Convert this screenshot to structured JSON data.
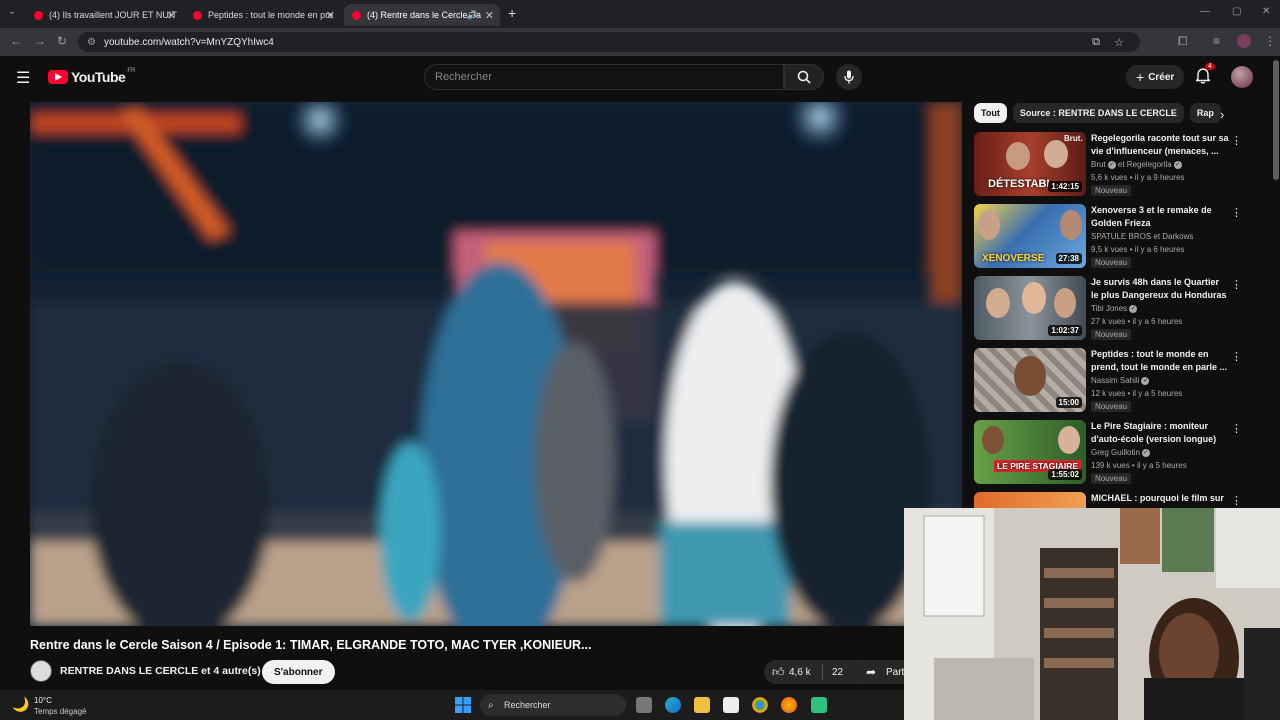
{
  "browser": {
    "tabs": [
      {
        "title": "(4) Ils travaillent JOUR ET NUIT",
        "close": "✕"
      },
      {
        "title": "Peptides : tout le monde en pre",
        "close": "✕"
      },
      {
        "title": "(4) Rentre dans le Cercle Sa",
        "close": "✕",
        "active": true
      }
    ],
    "new_tab": "+",
    "url": "youtube.com/watch?v=MnYZQYhIwc4"
  },
  "youtube": {
    "logo_text": "YouTube",
    "logo_region": "FR",
    "search_placeholder": "Rechercher",
    "create_label": "Créer",
    "notification_count": "4"
  },
  "video": {
    "title": "Rentre dans le Cercle Saison 4 / Episode 1: TIMAR, ELGRANDE TOTO, MAC TYER ,KONIEUR...",
    "channel": "RENTRE DANS LE CERCLE et 4 autre(s)",
    "subscribe_label": "S'abonner",
    "likes": "4,6 k",
    "dislike_count": "22",
    "share_label": "Part"
  },
  "chips": [
    {
      "label": "Tout",
      "active": true
    },
    {
      "label": "Source : RENTRE DANS LE CERCLE"
    },
    {
      "label": "Rap"
    }
  ],
  "recommendations": [
    {
      "title": "Regelegorila raconte tout sur sa vie d'influenceur (menaces, ...",
      "channel": "Brut",
      "channel_extra": "et Regelegorila",
      "stats": "5,6 k vues • il y a 9 heures",
      "badge": "Nouveau",
      "duration": "1:42:15",
      "thumb_text": "DÉTESTABI",
      "thumb_top_text": "Brut.",
      "thumb_color": "#8a2a1e"
    },
    {
      "title": "Xenoverse 3 et le remake de Golden Frieza",
      "channel": "SPATULE BROS et Darkows",
      "stats": "9,5 k vues • il y a 6 heures",
      "badge": "Nouveau",
      "duration": "27:38",
      "thumb_text": "XENOVERSE",
      "thumb_color": "#3a6fb0"
    },
    {
      "title": "Je survis 48h dans le Quartier le plus Dangereux du Honduras",
      "channel": "Tibi Jones",
      "stats": "27 k vues • il y a 6 heures",
      "badge": "Nouveau",
      "duration": "1:02:37",
      "thumb_text": "",
      "thumb_color": "#6d7a83"
    },
    {
      "title": "Peptides : tout le monde en prend, tout le monde en parle ...",
      "channel": "Nassim Sahili",
      "stats": "12 k vues • il y a 5 heures",
      "badge": "Nouveau",
      "duration": "15:00",
      "thumb_text": "",
      "thumb_color": "#a09a94"
    },
    {
      "title": "Le Pire Stagiaire : moniteur d'auto-école (version longue)",
      "channel": "Greg Guillotin",
      "stats": "139 k vues • il y a 5 heures",
      "badge": "Nouveau",
      "duration": "1:55:02",
      "thumb_text": "LE PIRE STAGIAIRE",
      "thumb_color": "#4f8a3a"
    },
    {
      "title": "MICHAEL : pourquoi le film sur",
      "channel": "",
      "stats": "",
      "badge": "",
      "duration": "",
      "thumb_text": "",
      "thumb_color": "#c86a2a"
    }
  ],
  "taskbar": {
    "weather_temp": "10°C",
    "weather_desc": "Temps dégagé",
    "search_label": "Rechercher"
  }
}
